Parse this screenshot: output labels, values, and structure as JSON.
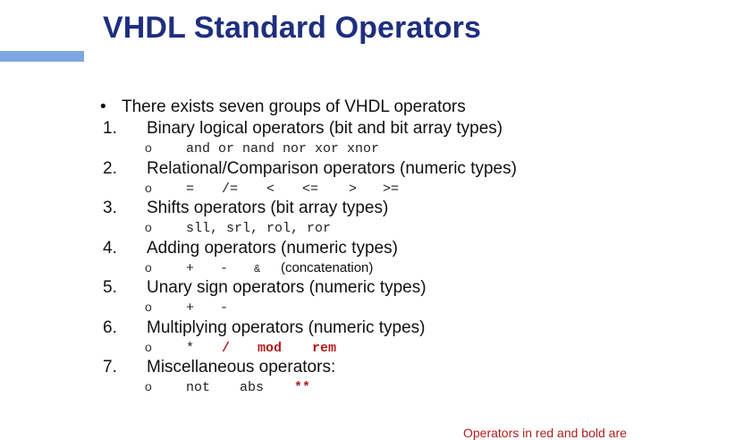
{
  "slide": {
    "title": "VHDL Standard Operators",
    "intro_bullet": "•",
    "intro": "There exists seven groups of VHDL operators",
    "sub_marker": "o",
    "footnote": "Operators in red and bold are"
  },
  "groups": [
    {
      "number": "1.",
      "title": "Binary logical operators (bit and bit array types)",
      "operators": [
        "and or nand nor xor xnor"
      ]
    },
    {
      "number": "2.",
      "title": "Relational/Comparison operators (numeric types)",
      "operators": [
        "=",
        "/=",
        "<",
        "<=",
        ">",
        ">="
      ]
    },
    {
      "number": "3.",
      "title": "Shifts operators (bit array types)",
      "operators": [
        "sll, srl, rol, ror"
      ]
    },
    {
      "number": "4.",
      "title": "Adding operators (numeric types)",
      "operators": [
        "+",
        "-",
        "&"
      ],
      "note": "(concatenation)"
    },
    {
      "number": "5.",
      "title": "Unary sign operators (numeric types)",
      "operators": [
        "+",
        "-"
      ]
    },
    {
      "number": "6.",
      "title": "Multiplying operators (numeric types)",
      "operators": [
        "*"
      ],
      "red_operators": [
        "/",
        "mod",
        "rem"
      ]
    },
    {
      "number": "7.",
      "title": "Miscellaneous operators:",
      "operators": [
        "not",
        "abs"
      ],
      "red_operators": [
        "**"
      ]
    }
  ],
  "colors": {
    "title": "#1f2f7f",
    "accent_bar": "#7ea6e0",
    "red_bold": "#b01c1c"
  }
}
